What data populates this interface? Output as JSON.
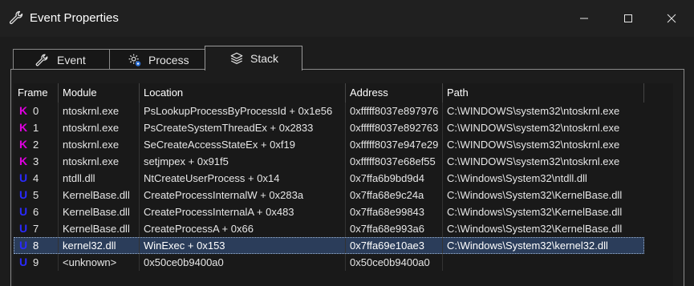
{
  "window": {
    "title": "Event Properties",
    "controls": {
      "minimize": "minimize",
      "maximize": "maximize",
      "close": "close"
    }
  },
  "tabs": [
    {
      "label": "Event",
      "icon": "wrench-icon",
      "active": false
    },
    {
      "label": "Process",
      "icon": "gear-process-icon",
      "active": false
    },
    {
      "label": "Stack",
      "icon": "layers-icon",
      "active": true
    }
  ],
  "table": {
    "columns": [
      "Frame",
      "Module",
      "Location",
      "Address",
      "Path"
    ],
    "rows": [
      {
        "mode": "K",
        "frame": "0",
        "module": "ntoskrnl.exe",
        "location": "PsLookupProcessByProcessId + 0x1e56",
        "address": "0xfffff8037e897976",
        "path": "C:\\WINDOWS\\system32\\ntoskrnl.exe"
      },
      {
        "mode": "K",
        "frame": "1",
        "module": "ntoskrnl.exe",
        "location": "PsCreateSystemThreadEx + 0x2833",
        "address": "0xfffff8037e892763",
        "path": "C:\\WINDOWS\\system32\\ntoskrnl.exe"
      },
      {
        "mode": "K",
        "frame": "2",
        "module": "ntoskrnl.exe",
        "location": "SeCreateAccessStateEx + 0xf19",
        "address": "0xfffff8037e947e29",
        "path": "C:\\WINDOWS\\system32\\ntoskrnl.exe"
      },
      {
        "mode": "K",
        "frame": "3",
        "module": "ntoskrnl.exe",
        "location": "setjmpex + 0x91f5",
        "address": "0xfffff8037e68ef55",
        "path": "C:\\WINDOWS\\system32\\ntoskrnl.exe"
      },
      {
        "mode": "U",
        "frame": "4",
        "module": "ntdll.dll",
        "location": "NtCreateUserProcess + 0x14",
        "address": "0x7ffa6b9bd9d4",
        "path": "C:\\Windows\\System32\\ntdll.dll"
      },
      {
        "mode": "U",
        "frame": "5",
        "module": "KernelBase.dll",
        "location": "CreateProcessInternalW + 0x283a",
        "address": "0x7ffa68e9c24a",
        "path": "C:\\Windows\\System32\\KernelBase.dll"
      },
      {
        "mode": "U",
        "frame": "6",
        "module": "KernelBase.dll",
        "location": "CreateProcessInternalA + 0x483",
        "address": "0x7ffa68e99843",
        "path": "C:\\Windows\\System32\\KernelBase.dll"
      },
      {
        "mode": "U",
        "frame": "7",
        "module": "KernelBase.dll",
        "location": "CreateProcessA + 0x66",
        "address": "0x7ffa68e993a6",
        "path": "C:\\Windows\\System32\\KernelBase.dll"
      },
      {
        "mode": "U",
        "frame": "8",
        "module": "kernel32.dll",
        "location": "WinExec + 0x153",
        "address": "0x7ffa69e10ae3",
        "path": "C:\\Windows\\System32\\kernel32.dll",
        "selected": true
      },
      {
        "mode": "U",
        "frame": "9",
        "module": "<unknown>",
        "location": "0x50ce0b9400a0",
        "address": "0x50ce0b9400a0",
        "path": ""
      }
    ]
  },
  "colors": {
    "kernel_badge": "#e000e0",
    "user_badge": "#2a2aff",
    "selection": "#2b3d5a"
  }
}
